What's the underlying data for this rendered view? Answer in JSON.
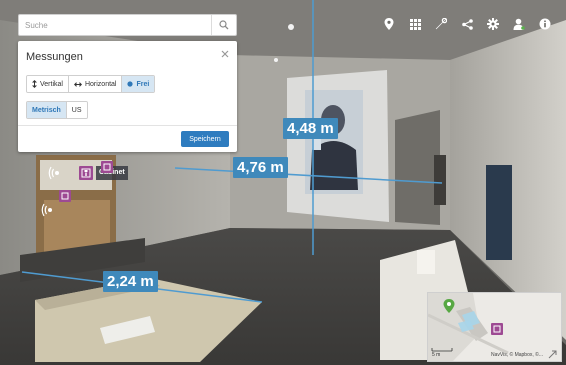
{
  "search": {
    "placeholder": "Suche"
  },
  "toolbar": {
    "items": [
      {
        "icon": "location-pin-icon"
      },
      {
        "icon": "grid-icon"
      },
      {
        "icon": "wrench-icon"
      },
      {
        "icon": "share-icon"
      },
      {
        "icon": "gear-icon"
      },
      {
        "icon": "user-icon"
      },
      {
        "icon": "info-icon"
      }
    ]
  },
  "measurement_panel": {
    "title": "Messungen",
    "modes": [
      {
        "label": "Vertikal",
        "icon": "vertical-arrow-icon",
        "active": false
      },
      {
        "label": "Horizontal",
        "icon": "horizontal-arrow-icon",
        "active": false
      },
      {
        "label": "Frei",
        "icon": "free-dot-icon",
        "active": true
      }
    ],
    "units": [
      {
        "label": "Metrisch",
        "active": true
      },
      {
        "label": "US",
        "active": false
      }
    ],
    "save_label": "Speichern"
  },
  "measurements": [
    {
      "id": "height",
      "value": "4,48 m"
    },
    {
      "id": "width",
      "value": "4,76 m"
    },
    {
      "id": "bed",
      "value": "2,24 m"
    }
  ],
  "poi": {
    "label": "Cabinet"
  },
  "minimap": {
    "scale": "5 m",
    "attribution": "NavVis, © Mapbox, ©..."
  },
  "colors": {
    "accent": "#2e7cbf",
    "measurement": "#3f89bb",
    "poi": "#9d4a93",
    "map_marker": "#57a843"
  }
}
